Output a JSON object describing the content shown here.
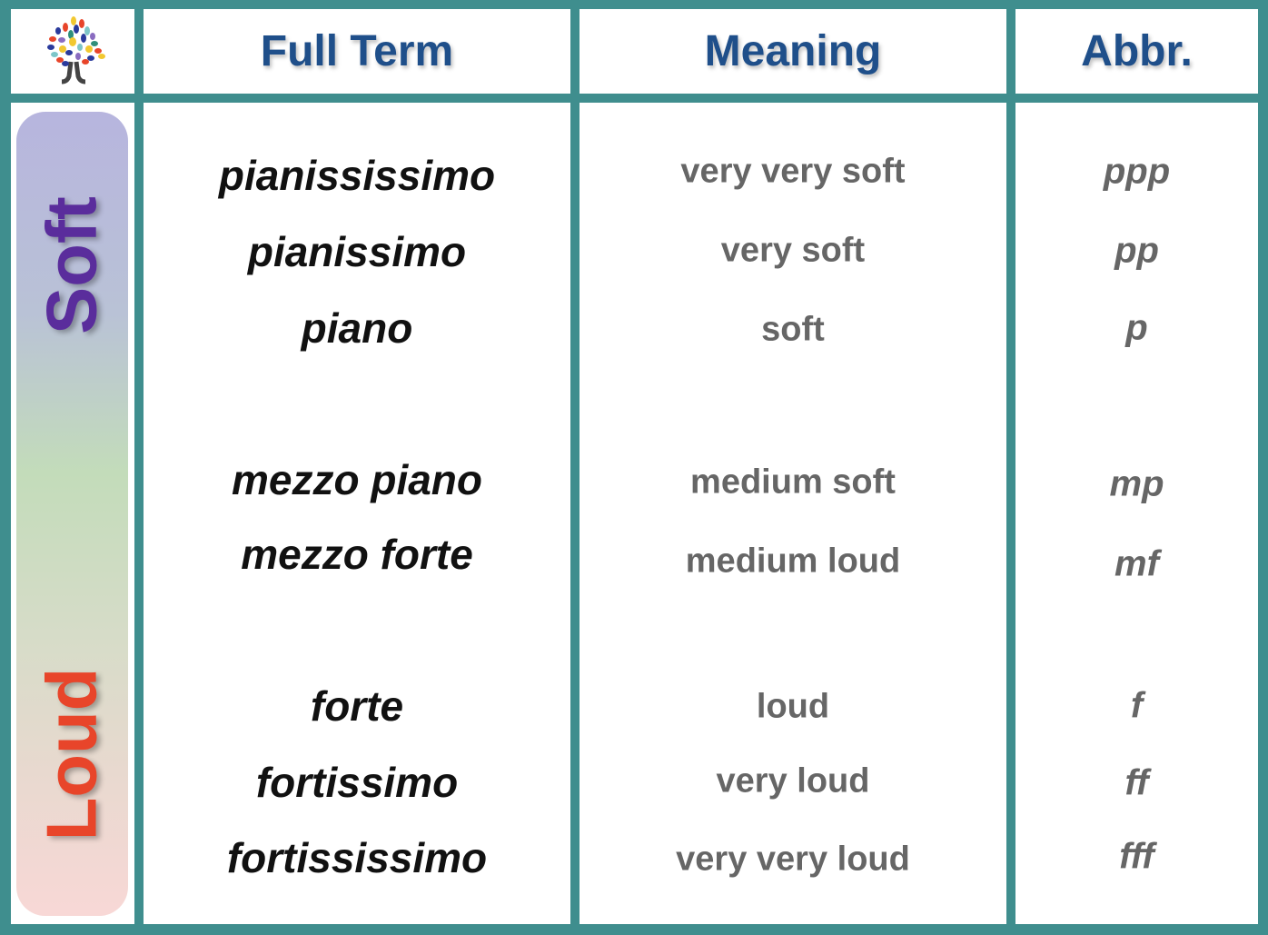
{
  "header": {
    "full_term": "Full Term",
    "meaning": "Meaning",
    "abbr": "Abbr."
  },
  "side_labels": {
    "soft": "Soft",
    "loud": "Loud"
  },
  "colors": {
    "border": "#3f8e8e",
    "header_text": "#1f4f8a",
    "soft": "#5a2d9c",
    "loud": "#e8452a"
  },
  "rows": [
    {
      "term": "pianississimo",
      "meaning": "very very soft",
      "abbr": "ppp"
    },
    {
      "term": "pianissimo",
      "meaning": "very soft",
      "abbr": "pp"
    },
    {
      "term": "piano",
      "meaning": "soft",
      "abbr": "p"
    },
    {
      "term": "mezzo piano",
      "meaning": "medium soft",
      "abbr": "mp"
    },
    {
      "term": "mezzo forte",
      "meaning": "medium loud",
      "abbr": "mf"
    },
    {
      "term": "forte",
      "meaning": "loud",
      "abbr": "f"
    },
    {
      "term": "fortissimo",
      "meaning": "very loud",
      "abbr": "ff"
    },
    {
      "term": "fortississimo",
      "meaning": "very very loud",
      "abbr": "fff"
    }
  ]
}
